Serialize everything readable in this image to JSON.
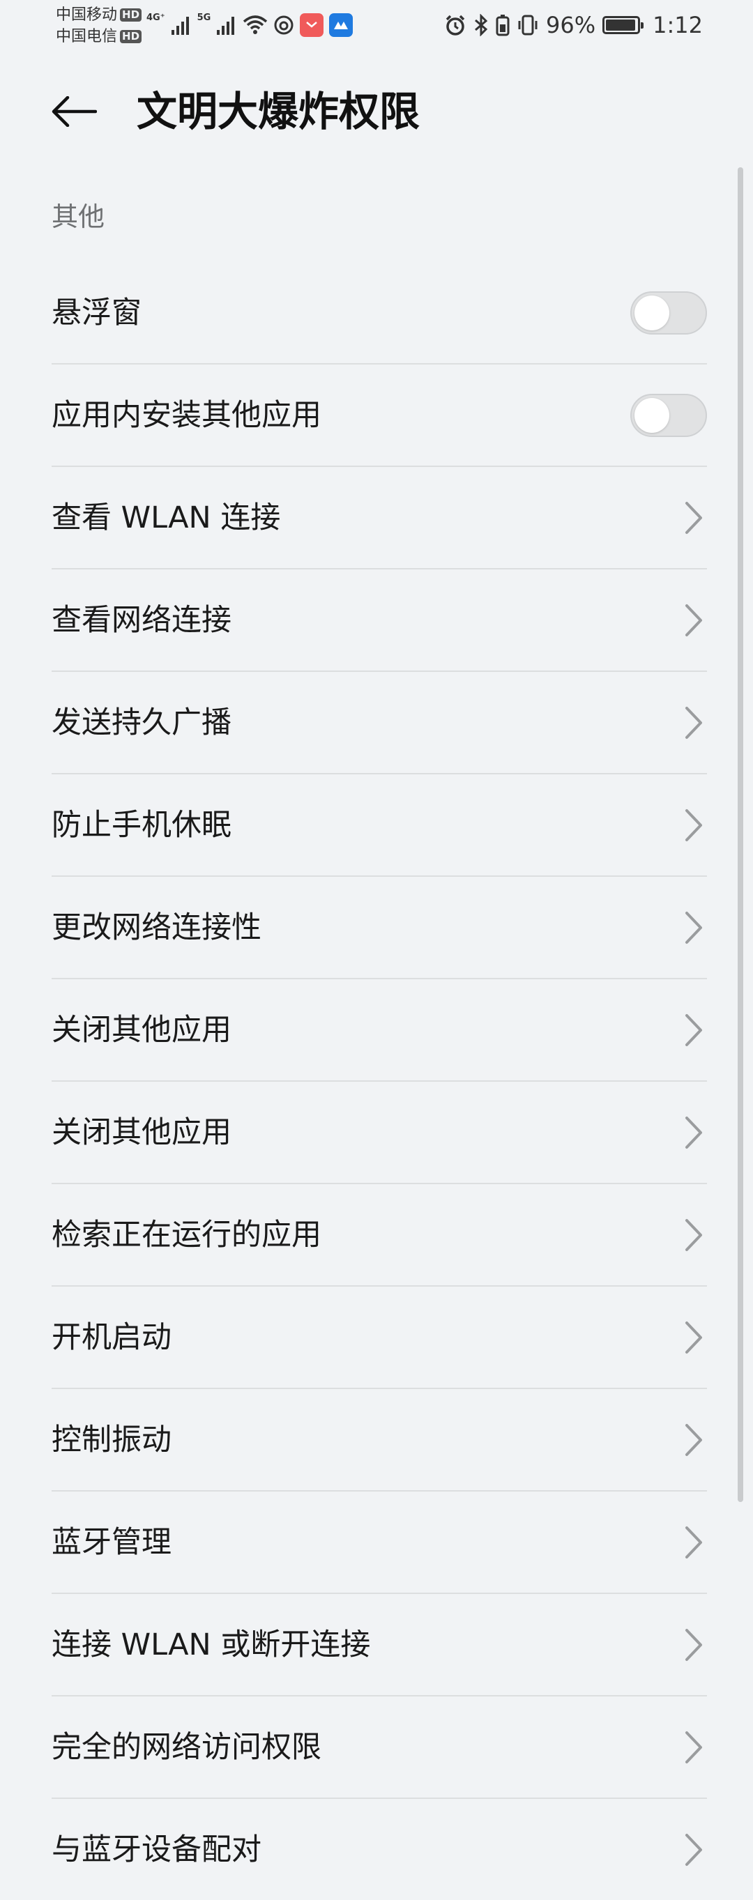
{
  "status_bar": {
    "carrier_1": "中国移动",
    "carrier_2": "中国电信",
    "hd_badge": "HD",
    "net_tag_1": "4G⁺",
    "net_tag_2": "5G",
    "battery_percent": "96%",
    "battery_level": 0.96,
    "time": "1:12",
    "icons": [
      "signal-icon",
      "wifi-icon",
      "netease-app-icon",
      "red-app-icon",
      "blue-app-icon",
      "alarm-icon",
      "bluetooth-icon",
      "battery-saver-icon",
      "vibrate-icon",
      "battery-icon"
    ]
  },
  "header": {
    "title": "文明大爆炸权限",
    "back_icon": "back-arrow-icon"
  },
  "section": {
    "title": "其他"
  },
  "items": [
    {
      "label": "悬浮窗",
      "control": "toggle",
      "on": false
    },
    {
      "label": "应用内安装其他应用",
      "control": "toggle",
      "on": false
    },
    {
      "label": "查看 WLAN 连接",
      "control": "chevron"
    },
    {
      "label": "查看网络连接",
      "control": "chevron"
    },
    {
      "label": "发送持久广播",
      "control": "chevron"
    },
    {
      "label": "防止手机休眠",
      "control": "chevron"
    },
    {
      "label": "更改网络连接性",
      "control": "chevron"
    },
    {
      "label": "关闭其他应用",
      "control": "chevron"
    },
    {
      "label": "关闭其他应用",
      "control": "chevron"
    },
    {
      "label": "检索正在运行的应用",
      "control": "chevron"
    },
    {
      "label": "开机启动",
      "control": "chevron"
    },
    {
      "label": "控制振动",
      "control": "chevron"
    },
    {
      "label": "蓝牙管理",
      "control": "chevron"
    },
    {
      "label": "连接 WLAN 或断开连接",
      "control": "chevron"
    },
    {
      "label": "完全的网络访问权限",
      "control": "chevron"
    },
    {
      "label": "与蓝牙设备配对",
      "control": "chevron"
    }
  ],
  "colors": {
    "background": "#f1f3f5",
    "divider": "#dcdedf",
    "section_text": "#6f7173",
    "toggle_off_track": "#e1e2e3"
  }
}
